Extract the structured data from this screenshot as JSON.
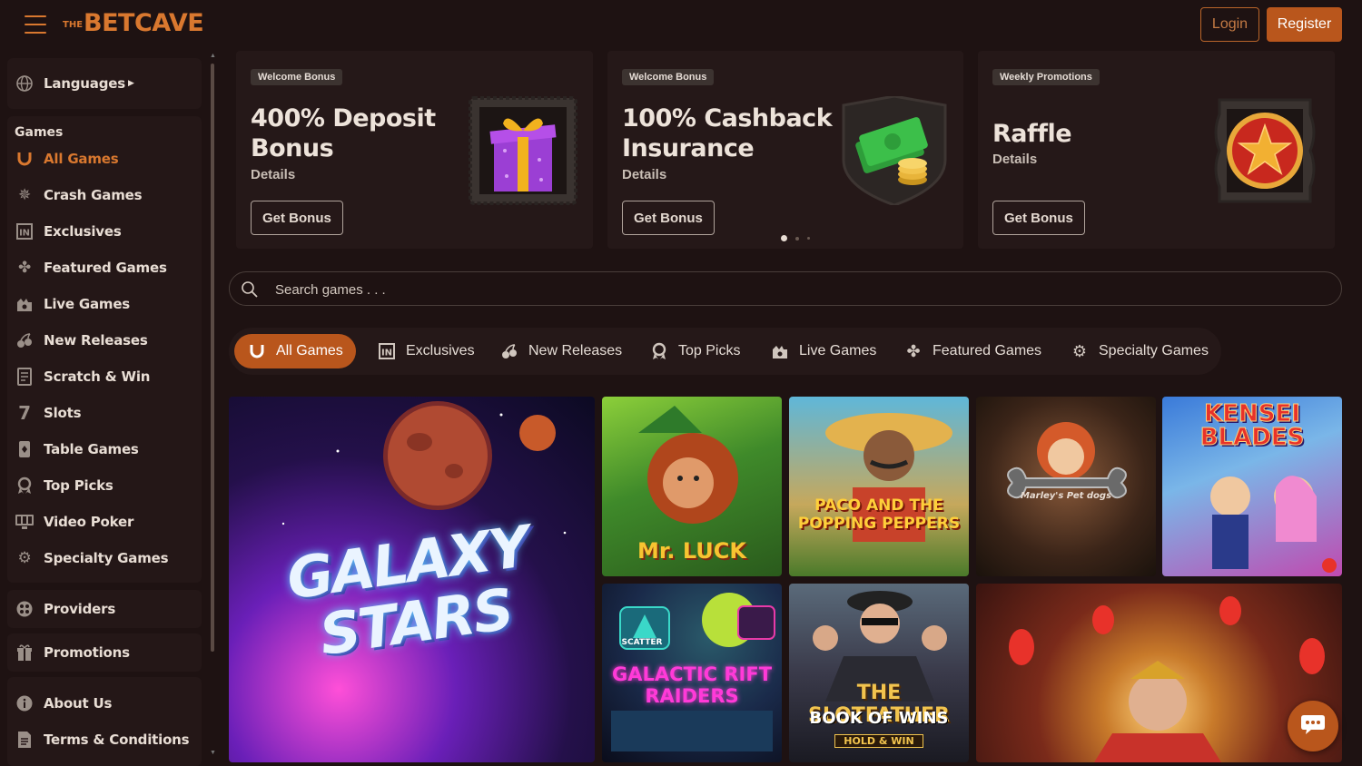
{
  "header": {
    "logo_the": "THE",
    "logo_main": "BETCAVE",
    "login_label": "Login",
    "register_label": "Register"
  },
  "sidebar": {
    "languages_label": "Languages",
    "games_heading": "Games",
    "items": [
      {
        "label": "All Games",
        "icon": "horseshoe-icon",
        "active": true
      },
      {
        "label": "Crash Games",
        "icon": "crash-icon"
      },
      {
        "label": "Exclusives",
        "icon": "exclusive-icon"
      },
      {
        "label": "Featured Games",
        "icon": "clover-icon"
      },
      {
        "label": "Live Games",
        "icon": "live-icon"
      },
      {
        "label": "New Releases",
        "icon": "cherries-icon"
      },
      {
        "label": "Scratch & Win",
        "icon": "scratch-icon"
      },
      {
        "label": "Slots",
        "icon": "seven-icon"
      },
      {
        "label": "Table Games",
        "icon": "cards-icon"
      },
      {
        "label": "Top Picks",
        "icon": "medal-icon"
      },
      {
        "label": "Video Poker",
        "icon": "monitor-icon"
      },
      {
        "label": "Specialty Games",
        "icon": "gear-icon"
      }
    ],
    "providers_label": "Providers",
    "promotions_label": "Promotions",
    "about_label": "About Us",
    "terms_label": "Terms & Conditions"
  },
  "promos": [
    {
      "tag": "Welcome Bonus",
      "title_1": "400% Deposit",
      "title_2": "Bonus",
      "details": "Details",
      "button": "Get Bonus",
      "art": "gift-box-icon"
    },
    {
      "tag": "Welcome Bonus",
      "title_1": "100% Cashback",
      "title_2": "Insurance",
      "details": "Details",
      "button": "Get Bonus",
      "art": "cash-coins-icon"
    },
    {
      "tag": "Weekly Promotions",
      "title_1": "Raffle",
      "details": "Details",
      "button": "Get Bonus",
      "art": "star-coin-icon"
    }
  ],
  "carousel": {
    "pages": 3,
    "current": 1
  },
  "search": {
    "placeholder": "Search games . . ."
  },
  "tabs": [
    {
      "label": "All Games",
      "icon": "horseshoe-icon",
      "active": true
    },
    {
      "label": "Exclusives",
      "icon": "exclusive-icon"
    },
    {
      "label": "New Releases",
      "icon": "cherries-icon"
    },
    {
      "label": "Top Picks",
      "icon": "medal-icon"
    },
    {
      "label": "Live Games",
      "icon": "live-icon"
    },
    {
      "label": "Featured Games",
      "icon": "clover-icon"
    },
    {
      "label": "Specialty Games",
      "icon": "gear-icon"
    }
  ],
  "games": [
    {
      "name": "GALAXY STARS"
    },
    {
      "name": "Mr. LUCK"
    },
    {
      "name": "PACO AND THE POPPING PEPPERS"
    },
    {
      "name": "Marley's Pet dogs"
    },
    {
      "name": "KENSEI BLADES"
    },
    {
      "name": "GALACTIC RIFT RAIDERS",
      "badge": "SCATTER"
    },
    {
      "name_1": "THE SLOTFATHER",
      "name_2": "BOOK OF WINS",
      "badge": "HOLD & WIN"
    },
    {
      "name": ""
    }
  ],
  "colors": {
    "accent": "#b9561c",
    "logo": "#d9782f",
    "background": "#1e1212",
    "panel": "#251818"
  }
}
